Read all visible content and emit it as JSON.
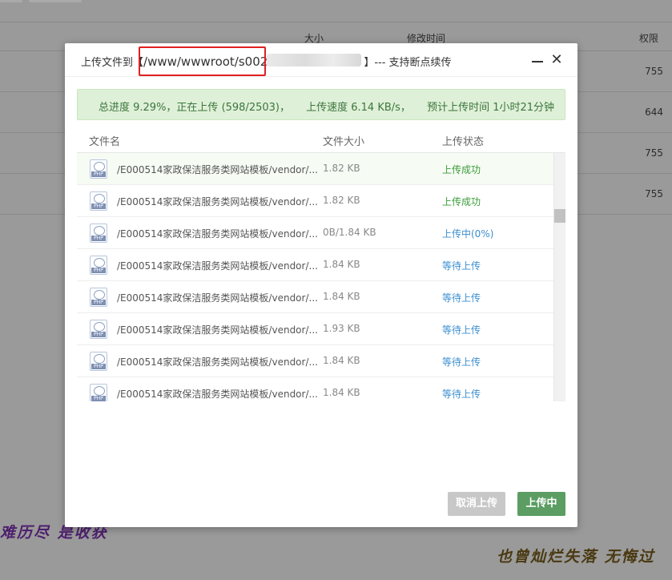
{
  "background": {
    "columns": {
      "size": "大小",
      "modified": "修改时间",
      "permissions": "权限"
    },
    "rows": [
      {
        "permissions": "755"
      },
      {
        "permissions": "644"
      },
      {
        "permissions": "755"
      },
      {
        "permissions": "755"
      }
    ]
  },
  "modal": {
    "title_prefix": "上传文件到【",
    "title_path": "/www/wwwroot/s002",
    "title_suffix": "】--- 支持断点续传",
    "progress": {
      "total": "总进度 9.29%，正在上传 (598/2503)，",
      "speed": "上传速度 6.14 KB/s，",
      "eta": "预计上传时间 1小时21分钟"
    },
    "table": {
      "headers": {
        "name": "文件名",
        "size": "文件大小",
        "status": "上传状态"
      },
      "rows": [
        {
          "name": "/E000514家政保洁服务类网站模板/vendor/...",
          "size": "1.82 KB",
          "status": "上传成功",
          "status_color": "#3a9d3a"
        },
        {
          "name": "/E000514家政保洁服务类网站模板/vendor/...",
          "size": "1.82 KB",
          "status": "上传成功",
          "status_color": "#3a9d3a"
        },
        {
          "name": "/E000514家政保洁服务类网站模板/vendor/...",
          "size": "0B/1.84 KB",
          "status": "上传中(0%)",
          "status_color": "#3b8fd1"
        },
        {
          "name": "/E000514家政保洁服务类网站模板/vendor/...",
          "size": "1.84 KB",
          "status": "等待上传",
          "status_color": "#3b8fd1"
        },
        {
          "name": "/E000514家政保洁服务类网站模板/vendor/...",
          "size": "1.84 KB",
          "status": "等待上传",
          "status_color": "#3b8fd1"
        },
        {
          "name": "/E000514家政保洁服务类网站模板/vendor/...",
          "size": "1.93 KB",
          "status": "等待上传",
          "status_color": "#3b8fd1"
        },
        {
          "name": "/E000514家政保洁服务类网站模板/vendor/...",
          "size": "1.84 KB",
          "status": "等待上传",
          "status_color": "#3b8fd1"
        },
        {
          "name": "/E000514家政保洁服务类网站模板/vendor/...",
          "size": "1.84 KB",
          "status": "等待上传",
          "status_color": "#3b8fd1"
        }
      ]
    },
    "buttons": {
      "cancel": "取消上传",
      "uploading": "上传中"
    },
    "icons": {
      "minimize": "minimize-icon",
      "close": "close-icon",
      "file": "php-file-icon"
    }
  },
  "watermarks": {
    "left": "难历尽 是收获",
    "right": "也曾灿烂失落 无悔过"
  },
  "colors": {
    "success": "#3a9d3a",
    "pending": "#3b8fd1",
    "progress_bg": "#dff0d8",
    "primary_button": "#5b9d62",
    "highlight_border": "#e02020"
  }
}
